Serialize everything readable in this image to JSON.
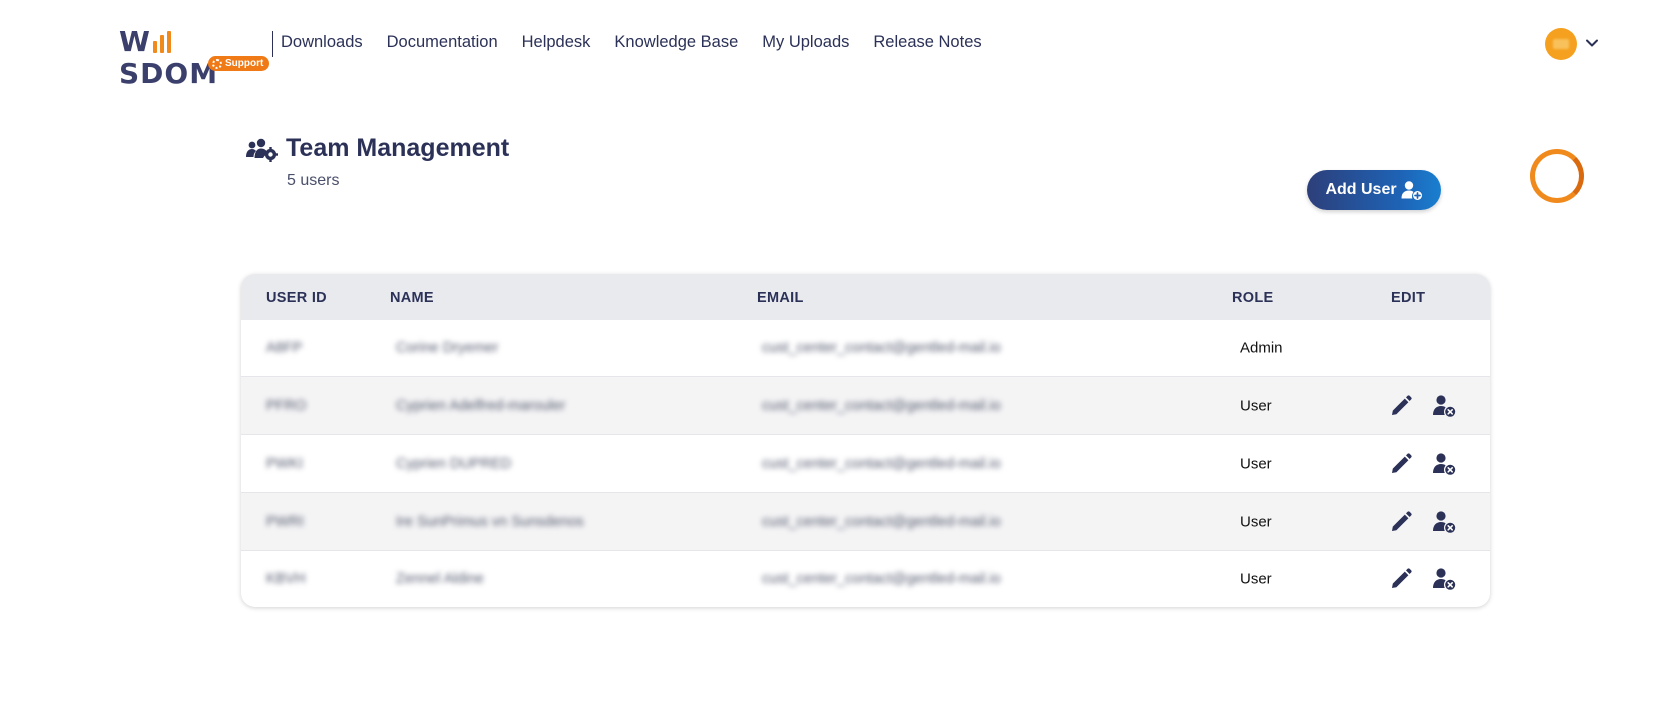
{
  "header": {
    "logo": {
      "brand": "WIISDOM",
      "badge": "Support"
    },
    "nav": [
      {
        "label": "Downloads"
      },
      {
        "label": "Documentation"
      },
      {
        "label": "Helpdesk"
      },
      {
        "label": "Knowledge Base"
      },
      {
        "label": "My Uploads"
      },
      {
        "label": "Release Notes"
      }
    ]
  },
  "page": {
    "title": "Team Management",
    "user_count": "5 users",
    "add_user_label": "Add User"
  },
  "table": {
    "columns": {
      "user_id": "USER ID",
      "name": "NAME",
      "email": "EMAIL",
      "role": "ROLE",
      "edit": "EDIT"
    },
    "rows": [
      {
        "user_id": "A8FP",
        "name": "Corine Dryemer",
        "email": "cust_center_contact@gentled-mail.io",
        "role": "Admin",
        "editable": false
      },
      {
        "user_id": "PFRO",
        "name": "Cyprien Adelfred-marouler",
        "email": "cust_center_contact@gentled-mail.io",
        "role": "User",
        "editable": true
      },
      {
        "user_id": "PWKI",
        "name": "Cyprien DUPRED",
        "email": "cust_center_contact@gentled-mail.io",
        "role": "User",
        "editable": true
      },
      {
        "user_id": "PWRI",
        "name": "Ire SunPrimus vn Sunsdenos",
        "email": "cust_center_contact@gentled-mail.io",
        "role": "User",
        "editable": true
      },
      {
        "user_id": "KBVH",
        "name": "Zennel Aldine",
        "email": "cust_center_contact@gentled-mail.io",
        "role": "User",
        "editable": true
      }
    ]
  },
  "colors": {
    "primary_text": "#2b3157",
    "accent_orange": "#f08a1c",
    "button_gradient_start": "#2d3f7a",
    "button_gradient_end": "#1a7fd0",
    "table_header_bg": "#e9eaee"
  },
  "icons": {
    "title": "users-gear-icon",
    "add_user": "user-plus-icon",
    "edit": "pencil-icon",
    "remove": "user-remove-icon",
    "account_menu": "chevron-down-icon"
  }
}
